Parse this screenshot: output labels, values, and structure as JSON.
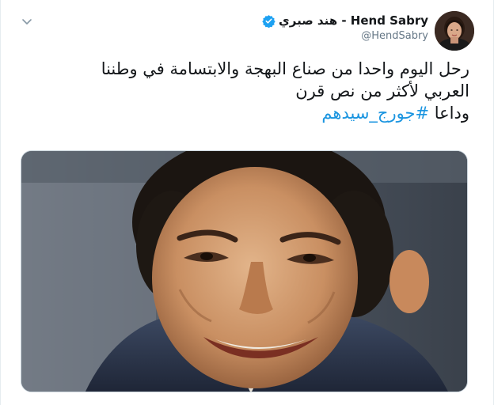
{
  "tweet": {
    "display_name": "هند صبري - Hend Sabry",
    "handle": "@HendSabry",
    "lines": [
      "رحل اليوم واحدا من صناع البهجة والابتسامة في وطننا",
      "العربي لأكثر من نص قرن",
      "وداعا "
    ],
    "hashtag": "#جورج_سيدهم"
  },
  "icons": {
    "caret": "chevron-down-icon",
    "verified": "verified-badge-icon"
  },
  "colors": {
    "accent": "#1da1f2",
    "hashtag": "#1b95e0",
    "secondary_text": "#657786",
    "border": "#e6ecf0"
  }
}
